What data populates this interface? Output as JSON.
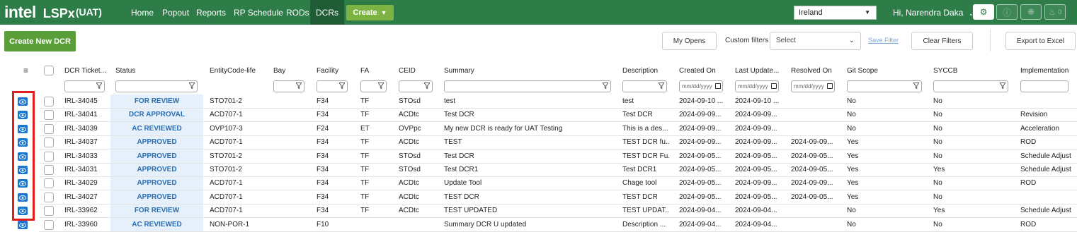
{
  "brand": {
    "logo": "intel",
    "app": "LSPx",
    "env": "(UAT)"
  },
  "nav": {
    "items": [
      "Home",
      "Popout",
      "Reports",
      "RP Schedule",
      "RODs",
      "DCRs"
    ],
    "active": "DCRs",
    "create_label": "Create",
    "region": "Ireland",
    "user_greeting": "Hi, Narendra Daka",
    "bell_count": "0",
    "icons": [
      "gear-icon",
      "info-icon",
      "bug-icon",
      "bell-icon"
    ]
  },
  "toolbar": {
    "create_new_label": "Create New DCR",
    "my_opens_label": "My Opens",
    "custom_filters_label": "Custom filters",
    "custom_filters_value": "Select",
    "save_filter_label": "Save Filter",
    "clear_filters_label": "Clear Filters",
    "export_label": "Export to Excel"
  },
  "grid": {
    "columns": [
      "DCR Ticket...",
      "Status",
      "EntityCode-life",
      "Bay",
      "Facility",
      "FA",
      "CEID",
      "Summary",
      "Description",
      "Created On",
      "Last Update...",
      "Resolved On",
      "Git Scope",
      "SYCCB",
      "Implementation"
    ],
    "date_placeholder": "mm/dd/yyyy",
    "rows": [
      [
        "IRL-34045",
        "FOR REVIEW",
        "STO701-2",
        "",
        "F34",
        "TF",
        "STOsd",
        "test",
        "test",
        "2024-09-10 ...",
        "2024-09-10 ...",
        "",
        "No",
        "No",
        ""
      ],
      [
        "IRL-34041",
        "DCR APPROVAL",
        "ACD707-1",
        "",
        "F34",
        "TF",
        "ACDtc",
        "Test DCR",
        "Test DCR",
        "2024-09-09...",
        "2024-09-09...",
        "",
        "No",
        "No",
        "Revision"
      ],
      [
        "IRL-34039",
        "AC REVIEWED",
        "OVP107-3",
        "",
        "F24",
        "ET",
        "OVPpc",
        "My new DCR is ready for UAT Testing",
        "This is a des...",
        "2024-09-09...",
        "2024-09-09...",
        "",
        "No",
        "No",
        "Acceleration"
      ],
      [
        "IRL-34037",
        "APPROVED",
        "ACD707-1",
        "",
        "F34",
        "TF",
        "ACDtc",
        "TEST",
        "TEST DCR fu...",
        "2024-09-09...",
        "2024-09-09...",
        "2024-09-09...",
        "Yes",
        "No",
        "ROD"
      ],
      [
        "IRL-34033",
        "APPROVED",
        "STO701-2",
        "",
        "F34",
        "TF",
        "STOsd",
        "Test DCR",
        "TEST DCR Fu...",
        "2024-09-05...",
        "2024-09-05...",
        "2024-09-05...",
        "Yes",
        "No",
        "Schedule Adjust"
      ],
      [
        "IRL-34031",
        "APPROVED",
        "STO701-2",
        "",
        "F34",
        "TF",
        "STOsd",
        "Test DCR1",
        "Test DCR1",
        "2024-09-05...",
        "2024-09-05...",
        "2024-09-05...",
        "Yes",
        "Yes",
        "Schedule Adjust"
      ],
      [
        "IRL-34029",
        "APPROVED",
        "ACD707-1",
        "",
        "F34",
        "TF",
        "ACDtc",
        "Update Tool",
        "Chage tool",
        "2024-09-05...",
        "2024-09-09...",
        "2024-09-09...",
        "Yes",
        "No",
        "ROD"
      ],
      [
        "IRL-34027",
        "APPROVED",
        "ACD707-1",
        "",
        "F34",
        "TF",
        "ACDtc",
        "TEST DCR",
        "TEST DCR",
        "2024-09-05...",
        "2024-09-05...",
        "2024-09-05...",
        "Yes",
        "No",
        ""
      ],
      [
        "IRL-33962",
        "FOR REVIEW",
        "ACD707-1",
        "",
        "F34",
        "TF",
        "ACDtc",
        "TEST UPDATED",
        "TEST UPDAT...",
        "2024-09-04...",
        "2024-09-04...",
        "",
        "No",
        "Yes",
        "Schedule Adjust"
      ],
      [
        "IRL-33960",
        "AC REVIEWED",
        "NON-POR-1",
        "",
        "F10",
        "",
        "",
        "Summary DCR U updated",
        "Description ...",
        "2024-09-04...",
        "2024-09-04...",
        "",
        "No",
        "No",
        "ROD"
      ]
    ]
  },
  "colors": {
    "navbar": "#2e7d49",
    "create_btn": "#7cb342",
    "primary_btn": "#5a9e3a",
    "status_text": "#2a6fb3",
    "eye_btn": "#1976d2",
    "highlight": "#e01e1e"
  }
}
